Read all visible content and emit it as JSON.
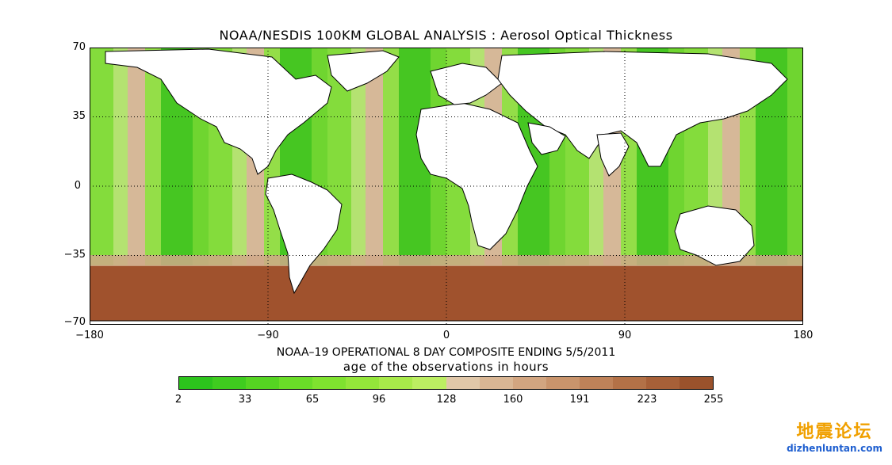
{
  "title": "NOAA/NESDIS 100KM GLOBAL ANALYSIS :  Aerosol Optical Thickness",
  "subtitle": "NOAA–19 OPERATIONAL 8 DAY COMPOSITE ENDING 5/5/2011",
  "map": {
    "lon_range": [
      -180,
      180
    ],
    "lat_range": [
      -70,
      70
    ],
    "lat_ticks": [
      "70",
      "35",
      "0",
      "−35",
      "−70"
    ],
    "lon_ticks": [
      "−180",
      "−90",
      "0",
      "90",
      "180"
    ],
    "gridlines": "dotted",
    "land_color": "#ffffff",
    "southern_band_color": "#a0522d"
  },
  "colorbar": {
    "title": "age of the observations in hours",
    "labels": [
      "2",
      "33",
      "65",
      "96",
      "128",
      "160",
      "191",
      "223",
      "255"
    ],
    "colors": [
      "#2cc41c",
      "#3fcc1f",
      "#55d422",
      "#6adc28",
      "#7fe22f",
      "#94e63a",
      "#a8ea4a",
      "#bcee62",
      "#e0c7a8",
      "#d9b694",
      "#d2a580",
      "#c9946c",
      "#bf8259",
      "#b37147",
      "#a76038",
      "#9a522c"
    ]
  },
  "watermark": {
    "chinese": "地震论坛",
    "url": "dizhenluntan.com"
  }
}
